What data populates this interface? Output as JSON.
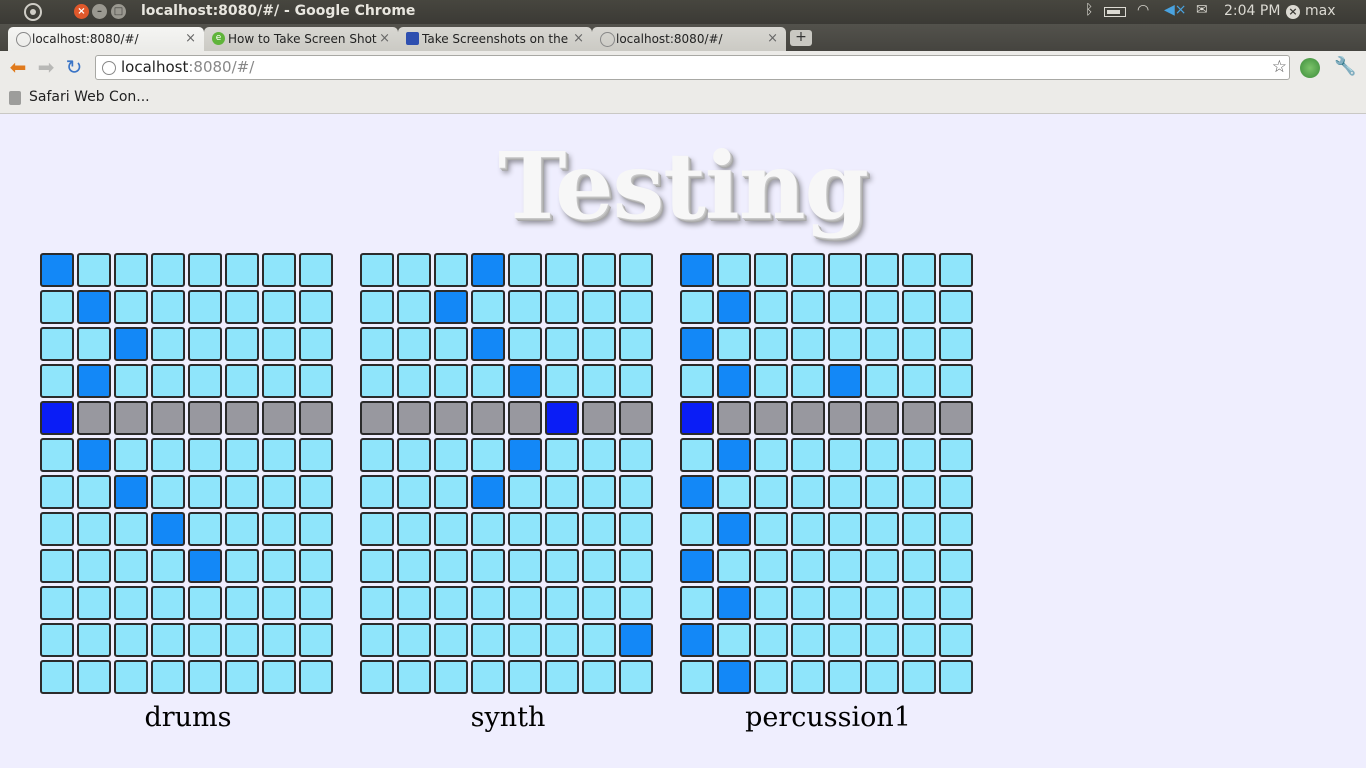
{
  "window": {
    "title": "localhost:8080/#/ - Google Chrome"
  },
  "system": {
    "clock": "2:04 PM",
    "user": "max"
  },
  "tabs": [
    {
      "label": "localhost:8080/#/",
      "active": true,
      "favicon": "page-icon"
    },
    {
      "label": "How to Take Screen Shot o",
      "active": false,
      "favicon": "e-icon"
    },
    {
      "label": "Take Screenshots on the H",
      "active": false,
      "favicon": "globe-icon"
    },
    {
      "label": "localhost:8080/#/",
      "active": false,
      "favicon": "page-icon"
    }
  ],
  "omnibox": {
    "host": "localhost",
    "path": ":8080/#/"
  },
  "bookmarks": [
    {
      "label": "Safari Web Con..."
    }
  ],
  "page": {
    "title": "Testing"
  },
  "colors": {
    "off": "#8fe5fb",
    "on": "#1388f7",
    "playhead": "#98989f",
    "playhead_on": "#0a1df6"
  },
  "playhead_row": 4,
  "sequencers": [
    {
      "name": "drums",
      "rows": [
        [
          1,
          0,
          0,
          0,
          0,
          0,
          0,
          0
        ],
        [
          0,
          1,
          0,
          0,
          0,
          0,
          0,
          0
        ],
        [
          0,
          0,
          1,
          0,
          0,
          0,
          0,
          0
        ],
        [
          0,
          1,
          0,
          0,
          0,
          0,
          0,
          0
        ],
        [
          1,
          0,
          0,
          0,
          0,
          0,
          0,
          0
        ],
        [
          0,
          1,
          0,
          0,
          0,
          0,
          0,
          0
        ],
        [
          0,
          0,
          1,
          0,
          0,
          0,
          0,
          0
        ],
        [
          0,
          0,
          0,
          1,
          0,
          0,
          0,
          0
        ],
        [
          0,
          0,
          0,
          0,
          1,
          0,
          0,
          0
        ],
        [
          0,
          0,
          0,
          0,
          0,
          0,
          0,
          0
        ],
        [
          0,
          0,
          0,
          0,
          0,
          0,
          0,
          0
        ],
        [
          0,
          0,
          0,
          0,
          0,
          0,
          0,
          0
        ]
      ]
    },
    {
      "name": "synth",
      "rows": [
        [
          0,
          0,
          0,
          1,
          0,
          0,
          0,
          0
        ],
        [
          0,
          0,
          1,
          0,
          0,
          0,
          0,
          0
        ],
        [
          0,
          0,
          0,
          1,
          0,
          0,
          0,
          0
        ],
        [
          0,
          0,
          0,
          0,
          1,
          0,
          0,
          0
        ],
        [
          0,
          0,
          0,
          0,
          0,
          1,
          0,
          0
        ],
        [
          0,
          0,
          0,
          0,
          1,
          0,
          0,
          0
        ],
        [
          0,
          0,
          0,
          1,
          0,
          0,
          0,
          0
        ],
        [
          0,
          0,
          0,
          0,
          0,
          0,
          0,
          0
        ],
        [
          0,
          0,
          0,
          0,
          0,
          0,
          0,
          0
        ],
        [
          0,
          0,
          0,
          0,
          0,
          0,
          0,
          0
        ],
        [
          0,
          0,
          0,
          0,
          0,
          0,
          0,
          1
        ],
        [
          0,
          0,
          0,
          0,
          0,
          0,
          0,
          0
        ]
      ]
    },
    {
      "name": "percussion1",
      "rows": [
        [
          1,
          0,
          0,
          0,
          0,
          0,
          0,
          0
        ],
        [
          0,
          1,
          0,
          0,
          0,
          0,
          0,
          0
        ],
        [
          1,
          0,
          0,
          0,
          0,
          0,
          0,
          0
        ],
        [
          0,
          1,
          0,
          0,
          1,
          0,
          0,
          0
        ],
        [
          1,
          0,
          0,
          0,
          0,
          0,
          0,
          0
        ],
        [
          0,
          1,
          0,
          0,
          0,
          0,
          0,
          0
        ],
        [
          1,
          0,
          0,
          0,
          0,
          0,
          0,
          0
        ],
        [
          0,
          1,
          0,
          0,
          0,
          0,
          0,
          0
        ],
        [
          1,
          0,
          0,
          0,
          0,
          0,
          0,
          0
        ],
        [
          0,
          1,
          0,
          0,
          0,
          0,
          0,
          0
        ],
        [
          1,
          0,
          0,
          0,
          0,
          0,
          0,
          0
        ],
        [
          0,
          1,
          0,
          0,
          0,
          0,
          0,
          0
        ]
      ]
    }
  ]
}
